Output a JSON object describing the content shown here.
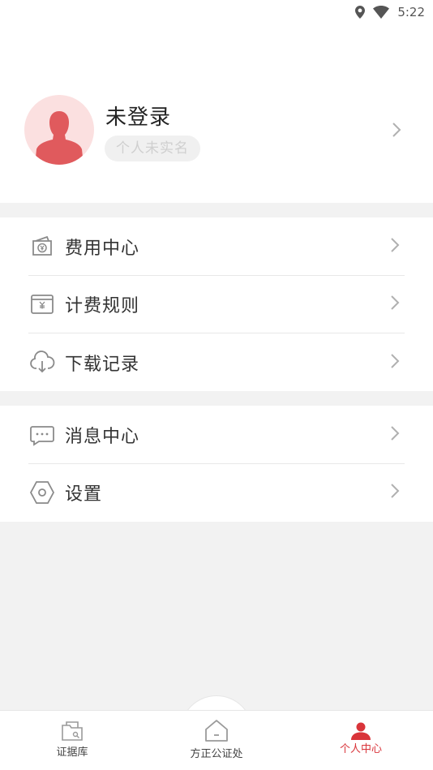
{
  "status_bar": {
    "time": "5:22"
  },
  "profile": {
    "name": "未登录",
    "realname_status": "个人未实名"
  },
  "menu_groups": [
    {
      "items": [
        {
          "label": "费用中心",
          "icon": "money-bag-icon"
        },
        {
          "label": "计费规则",
          "icon": "billing-rules-icon"
        },
        {
          "label": "下载记录",
          "icon": "cloud-download-icon"
        }
      ]
    },
    {
      "items": [
        {
          "label": "消息中心",
          "icon": "message-icon"
        },
        {
          "label": "设置",
          "icon": "settings-hexagon-icon"
        }
      ]
    }
  ],
  "bottom_nav": {
    "items": [
      {
        "label": "证据库",
        "icon": "evidence-folder-icon",
        "active": false
      },
      {
        "label": "方正公证处",
        "icon": "home-icon",
        "active": false
      },
      {
        "label": "个人中心",
        "icon": "user-icon",
        "active": true
      }
    ]
  },
  "colors": {
    "accent": "#d9343a",
    "avatar_bg": "#fbe0e0",
    "avatar_figure": "#e05a5d",
    "icon_gray": "#8a8a8a"
  }
}
